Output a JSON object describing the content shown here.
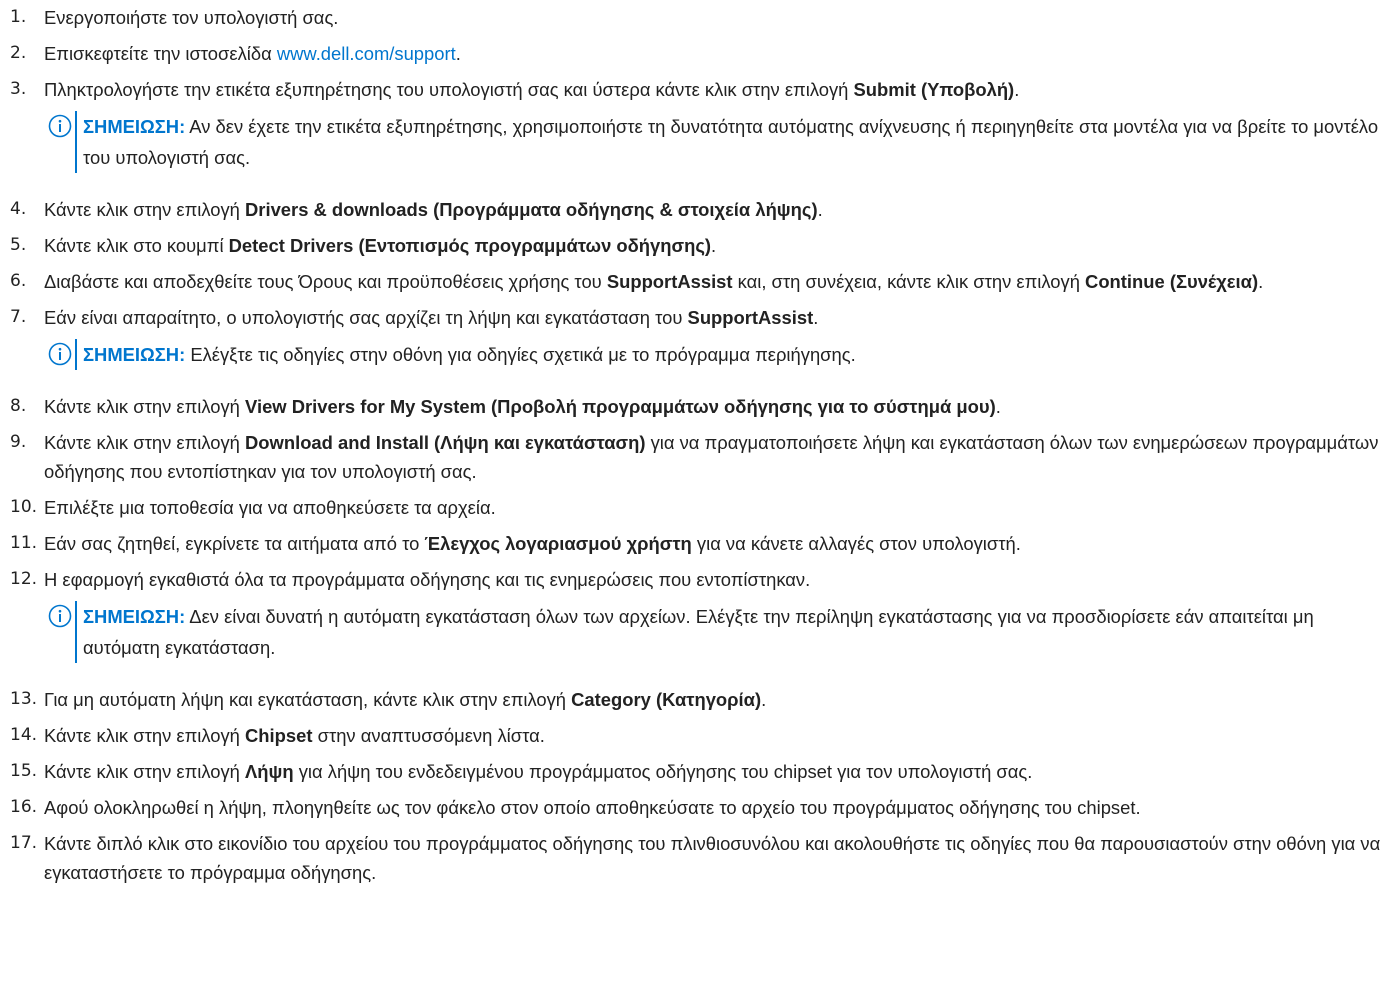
{
  "steps": [
    {
      "num": "1.",
      "parts": [
        {
          "t": "Ενεργοποιήστε τον υπολογιστή σας."
        }
      ]
    },
    {
      "num": "2.",
      "parts": [
        {
          "t": "Επισκεφτείτε την ιστοσελίδα "
        },
        {
          "t": "www.dell.com/support",
          "link": true
        },
        {
          "t": "."
        }
      ]
    },
    {
      "num": "3.",
      "parts": [
        {
          "t": "Πληκτρολογήστε την ετικέτα εξυπηρέτησης του υπολογιστή σας και ύστερα κάντε κλικ στην επιλογή "
        },
        {
          "t": "Submit (Υποβολή)",
          "bold": true
        },
        {
          "t": "."
        }
      ],
      "note": {
        "label": "ΣΗΜΕΙΩΣΗ:",
        "text": " Αν δεν έχετε την ετικέτα εξυπηρέτησης, χρησιμοποιήστε τη δυνατότητα αυτόματης ανίχνευσης ή περιηγηθείτε στα μοντέλα για να βρείτε το μοντέλο του υπολογιστή σας."
      }
    },
    {
      "num": "4.",
      "parts": [
        {
          "t": "Κάντε κλικ στην επιλογή "
        },
        {
          "t": "Drivers & downloads (Προγράμματα οδήγησης & στοιχεία λήψης)",
          "bold": true
        },
        {
          "t": "."
        }
      ]
    },
    {
      "num": "5.",
      "parts": [
        {
          "t": "Κάντε κλικ στο κουμπί "
        },
        {
          "t": "Detect Drivers (Εντοπισμός προγραμμάτων οδήγησης)",
          "bold": true
        },
        {
          "t": "."
        }
      ]
    },
    {
      "num": "6.",
      "parts": [
        {
          "t": "Διαβάστε και αποδεχθείτε τους Όρους και προϋποθέσεις χρήσης του "
        },
        {
          "t": "SupportAssist",
          "bold": true
        },
        {
          "t": " και, στη συνέχεια, κάντε κλικ στην επιλογή "
        },
        {
          "t": "Continue (Συνέχεια)",
          "bold": true
        },
        {
          "t": "."
        }
      ]
    },
    {
      "num": "7.",
      "parts": [
        {
          "t": "Εάν είναι απαραίτητο, ο υπολογιστής σας αρχίζει τη λήψη και εγκατάσταση του "
        },
        {
          "t": "SupportAssist",
          "bold": true
        },
        {
          "t": "."
        }
      ],
      "note": {
        "label": "ΣΗΜΕΙΩΣΗ:",
        "text": " Ελέγξτε τις οδηγίες στην οθόνη για οδηγίες σχετικά με το πρόγραμμα περιήγησης."
      }
    },
    {
      "num": "8.",
      "parts": [
        {
          "t": "Κάντε κλικ στην επιλογή "
        },
        {
          "t": "View Drivers for My System (Προβολή προγραμμάτων οδήγησης για το σύστημά μου)",
          "bold": true
        },
        {
          "t": "."
        }
      ]
    },
    {
      "num": "9.",
      "parts": [
        {
          "t": "Κάντε κλικ στην επιλογή "
        },
        {
          "t": "Download and Install (Λήψη και εγκατάσταση)",
          "bold": true
        },
        {
          "t": " για να πραγματοποιήσετε λήψη και εγκατάσταση όλων των ενημερώσεων προγραμμάτων οδήγησης που εντοπίστηκαν για τον υπολογιστή σας."
        }
      ]
    },
    {
      "num": "10.",
      "parts": [
        {
          "t": "Επιλέξτε μια τοποθεσία για να αποθηκεύσετε τα αρχεία."
        }
      ]
    },
    {
      "num": "11.",
      "parts": [
        {
          "t": "Εάν σας ζητηθεί, εγκρίνετε τα αιτήματα από το "
        },
        {
          "t": "Έλεγχος λογαριασμού χρήστη",
          "bold": true
        },
        {
          "t": " για να κάνετε αλλαγές στον υπολογιστή."
        }
      ]
    },
    {
      "num": "12.",
      "parts": [
        {
          "t": "Η εφαρμογή εγκαθιστά όλα τα προγράμματα οδήγησης και τις ενημερώσεις που εντοπίστηκαν."
        }
      ],
      "note": {
        "label": "ΣΗΜΕΙΩΣΗ:",
        "text": " Δεν είναι δυνατή η αυτόματη εγκατάσταση όλων των αρχείων. Ελέγξτε την περίληψη εγκατάστασης για να προσδιορίσετε εάν απαιτείται μη αυτόματη εγκατάσταση."
      }
    },
    {
      "num": "13.",
      "parts": [
        {
          "t": "Για μη αυτόματη λήψη και εγκατάσταση, κάντε κλικ στην επιλογή "
        },
        {
          "t": "Category (Κατηγορία)",
          "bold": true
        },
        {
          "t": "."
        }
      ]
    },
    {
      "num": "14.",
      "parts": [
        {
          "t": "Κάντε κλικ στην επιλογή "
        },
        {
          "t": "Chipset",
          "bold": true
        },
        {
          "t": " στην αναπτυσσόμενη λίστα."
        }
      ]
    },
    {
      "num": "15.",
      "parts": [
        {
          "t": "Κάντε κλικ στην επιλογή "
        },
        {
          "t": "Λήψη",
          "bold": true
        },
        {
          "t": " για λήψη του ενδεδειγμένου προγράμματος οδήγησης του chipset για τον υπολογιστή σας."
        }
      ]
    },
    {
      "num": "16.",
      "parts": [
        {
          "t": "Αφού ολοκληρωθεί η λήψη, πλοηγηθείτε ως τον φάκελο στον οποίο αποθηκεύσατε το αρχείο του προγράμματος οδήγησης του chipset."
        }
      ]
    },
    {
      "num": "17.",
      "parts": [
        {
          "t": "Κάντε διπλό κλικ στο εικονίδιο του αρχείου του προγράμματος οδήγησης του πλινθιοσυνόλου και ακολουθήστε τις οδηγίες που θα παρουσιαστούν στην οθόνη για να εγκαταστήσετε το πρόγραμμα οδήγησης."
        }
      ]
    }
  ]
}
